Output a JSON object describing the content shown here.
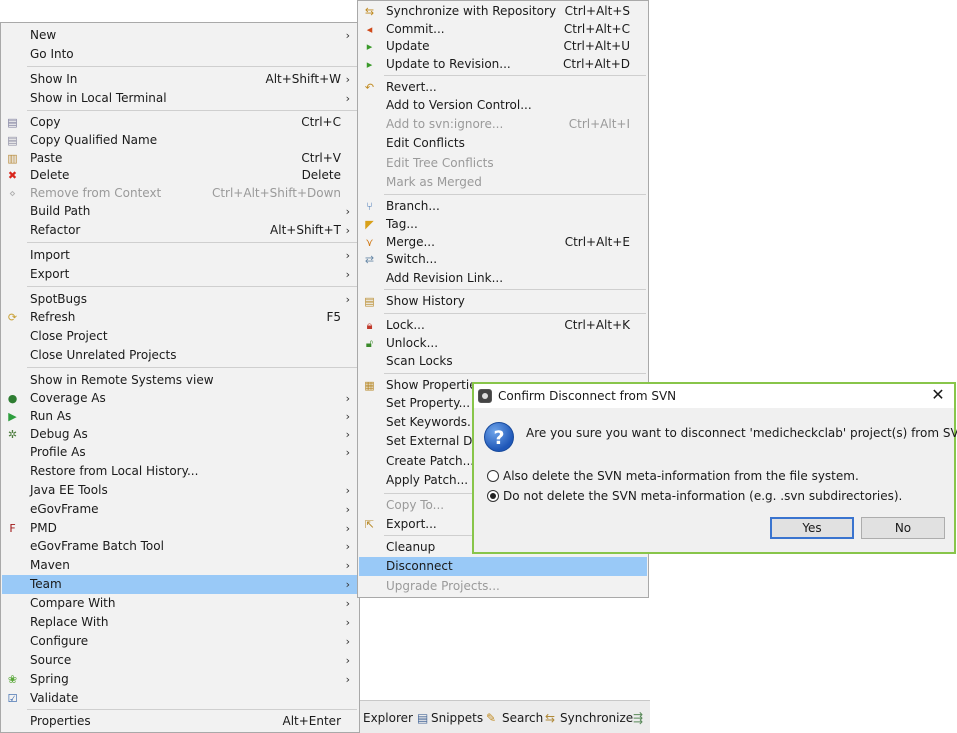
{
  "left_menu": {
    "items": [
      {
        "label": "New",
        "arrow": "›"
      },
      {
        "label": "Go Into"
      },
      {
        "label": "Show In",
        "accel": "Alt+Shift+W",
        "arrow": "›"
      },
      {
        "label": "Show in Local Terminal",
        "arrow": "›"
      },
      {
        "label": "Copy",
        "accel": "Ctrl+C",
        "icon": "copy-icon",
        "icon_glyph": "▤",
        "icon_color": "#7a7a9a"
      },
      {
        "label": "Copy Qualified Name",
        "icon": "copy-qualified-icon",
        "icon_glyph": "▤",
        "icon_color": "#8a8aa0"
      },
      {
        "label": "Paste",
        "accel": "Ctrl+V",
        "icon": "paste-icon",
        "icon_glyph": "▥",
        "icon_color": "#b78a3a"
      },
      {
        "label": "Delete",
        "accel": "Delete",
        "icon": "delete-icon",
        "icon_glyph": "✖",
        "icon_color": "#d9261c"
      },
      {
        "label": "Remove from Context",
        "accel": "Ctrl+Alt+Shift+Down",
        "icon": "remove-context-icon",
        "icon_glyph": "⋄",
        "icon_color": "#b0b0b0",
        "disabled": true
      },
      {
        "label": "Build Path",
        "arrow": "›"
      },
      {
        "label": "Refactor",
        "accel": "Alt+Shift+T",
        "arrow": "›"
      },
      {
        "label": "Import",
        "arrow": "›"
      },
      {
        "label": "Export",
        "arrow": "›"
      },
      {
        "label": "SpotBugs",
        "arrow": "›"
      },
      {
        "label": "Refresh",
        "accel": "F5",
        "icon": "refresh-icon",
        "icon_glyph": "⟳",
        "icon_color": "#c9a034"
      },
      {
        "label": "Close Project"
      },
      {
        "label": "Close Unrelated Projects"
      },
      {
        "label": "Show in Remote Systems view"
      },
      {
        "label": "Coverage As",
        "arrow": "›",
        "icon": "coverage-icon",
        "icon_glyph": "●",
        "icon_color": "#2e7d32"
      },
      {
        "label": "Run As",
        "arrow": "›",
        "icon": "run-icon",
        "icon_glyph": "▶",
        "icon_color": "#2e9e3e"
      },
      {
        "label": "Debug As",
        "arrow": "›",
        "icon": "debug-icon",
        "icon_glyph": "✲",
        "icon_color": "#4a7a3a"
      },
      {
        "label": "Profile As",
        "arrow": "›"
      },
      {
        "label": "Restore from Local History..."
      },
      {
        "label": "Java EE Tools",
        "arrow": "›"
      },
      {
        "label": "eGovFrame",
        "arrow": "›"
      },
      {
        "label": "PMD",
        "arrow": "›",
        "icon": "pmd-icon",
        "icon_glyph": "F",
        "icon_color": "#a01818"
      },
      {
        "label": "eGovFrame Batch Tool",
        "arrow": "›"
      },
      {
        "label": "Maven",
        "arrow": "›"
      },
      {
        "label": "Team",
        "arrow": "›",
        "selected": true
      },
      {
        "label": "Compare With",
        "arrow": "›"
      },
      {
        "label": "Replace With",
        "arrow": "›"
      },
      {
        "label": "Configure",
        "arrow": "›"
      },
      {
        "label": "Source",
        "arrow": "›"
      },
      {
        "label": "Spring",
        "arrow": "›",
        "icon": "spring-icon",
        "icon_glyph": "❀",
        "icon_color": "#5aa83a"
      },
      {
        "label": "Validate",
        "icon": "validate-icon",
        "icon_glyph": "☑",
        "icon_color": "#2d5fa8"
      },
      {
        "label": "Properties",
        "accel": "Alt+Enter"
      }
    ]
  },
  "right_menu": {
    "items": [
      {
        "label": "Synchronize with Repository",
        "accel": "Ctrl+Alt+S",
        "icon": "synchronize-icon",
        "icon_glyph": "⇆",
        "icon_color": "#c08a20"
      },
      {
        "label": "Commit...",
        "accel": "Ctrl+Alt+C",
        "icon": "commit-icon",
        "icon_glyph": "◂",
        "icon_color": "#d04a1a"
      },
      {
        "label": "Update",
        "accel": "Ctrl+Alt+U",
        "icon": "update-icon",
        "icon_glyph": "▸",
        "icon_color": "#3a9a2a"
      },
      {
        "label": "Update to Revision...",
        "accel": "Ctrl+Alt+D",
        "icon": "update-revision-icon",
        "icon_glyph": "▸",
        "icon_color": "#3a9a2a"
      },
      {
        "label": "Revert...",
        "icon": "revert-icon",
        "icon_glyph": "↶",
        "icon_color": "#c08a20"
      },
      {
        "label": "Add to Version Control..."
      },
      {
        "label": "Add to svn:ignore...",
        "accel": "Ctrl+Alt+I",
        "disabled": true
      },
      {
        "label": "Edit Conflicts"
      },
      {
        "label": "Edit Tree Conflicts",
        "disabled": true
      },
      {
        "label": "Mark as Merged",
        "disabled": true
      },
      {
        "label": "Branch...",
        "icon": "branch-icon",
        "icon_glyph": "⑂",
        "icon_color": "#4a7ab8"
      },
      {
        "label": "Tag...",
        "icon": "tag-icon",
        "icon_glyph": "◤",
        "icon_color": "#d8a018"
      },
      {
        "label": "Merge...",
        "accel": "Ctrl+Alt+E",
        "icon": "merge-icon",
        "icon_glyph": "⋎",
        "icon_color": "#d07a18"
      },
      {
        "label": "Switch...",
        "icon": "switch-icon",
        "icon_glyph": "⇄",
        "icon_color": "#6a8aa8"
      },
      {
        "label": "Add Revision Link..."
      },
      {
        "label": "Show History",
        "icon": "history-icon",
        "icon_glyph": "▤",
        "icon_color": "#b88a2a"
      },
      {
        "label": "Lock...",
        "accel": "Ctrl+Alt+K",
        "icon": "lock-icon",
        "icon_glyph": "🔒︎",
        "icon_color": "#c0392b"
      },
      {
        "label": "Unlock...",
        "icon": "unlock-icon",
        "icon_glyph": "🔓︎",
        "icon_color": "#3a8a2a"
      },
      {
        "label": "Scan Locks"
      },
      {
        "label": "Show Properties",
        "icon": "properties-icon",
        "icon_glyph": "▦",
        "icon_color": "#b88a2a"
      },
      {
        "label": "Set Property..."
      },
      {
        "label": "Set Keywords..."
      },
      {
        "label": "Set External Definitions..."
      },
      {
        "label": "Create Patch..."
      },
      {
        "label": "Apply Patch..."
      },
      {
        "label": "Copy To...",
        "disabled": true
      },
      {
        "label": "Export...",
        "icon": "export-icon",
        "icon_glyph": "⇱",
        "icon_color": "#b88a2a"
      },
      {
        "label": "Cleanup"
      },
      {
        "label": "Disconnect",
        "selected": true
      },
      {
        "label": "Upgrade Projects...",
        "disabled": true
      }
    ]
  },
  "bottom_tabs": {
    "explorer": "Explorer",
    "snippets": "Snippets",
    "search": "Search",
    "synchronize": "Synchronize"
  },
  "dialog": {
    "title": "Confirm Disconnect from SVN",
    "message": "Are you sure you want to disconnect 'medicheckclab' project(s) from SVN?",
    "option_delete": "Also delete the SVN meta-information from the file system.",
    "option_keep": "Do not delete the SVN meta-information (e.g. .svn subdirectories).",
    "selected_option": "keep",
    "yes_label": "Yes",
    "no_label": "No",
    "border_color": "#88c54a"
  }
}
